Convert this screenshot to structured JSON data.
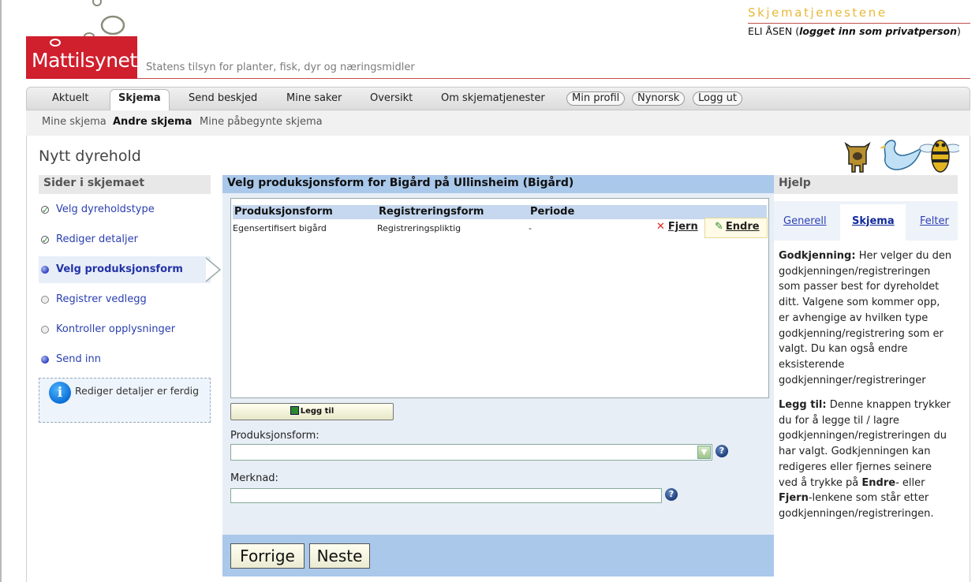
{
  "header": {
    "brand": "Mattilsynet",
    "tagline": "Statens tilsyn for planter, fisk, dyr og næringsmidler",
    "service_title": "Skjematjenestene",
    "user_name": "ELI ÅSEN",
    "user_status": "logget inn som privatperson",
    "paren_open": " (",
    "paren_close": ")",
    "brand_color": "#d01f2d",
    "accent_color": "#e8b838"
  },
  "nav": {
    "tabs": [
      "Aktuelt",
      "Skjema",
      "Send beskjed",
      "Mine saker",
      "Oversikt",
      "Om skjematjenester"
    ],
    "active_tab": "Skjema",
    "pills": [
      "Min profil",
      "Nynorsk",
      "Logg ut"
    ],
    "subtabs": [
      "Mine skjema",
      "Andre skjema",
      "Mine påbegynte skjema"
    ],
    "active_subtab": "Andre skjema"
  },
  "page": {
    "title": "Nytt dyrehold"
  },
  "sidebar": {
    "heading": "Sider i skjemaet",
    "steps": [
      {
        "label": "Velg dyreholdstype",
        "state": "done"
      },
      {
        "label": "Rediger detaljer",
        "state": "done"
      },
      {
        "label": "Velg produksjonsform",
        "state": "current"
      },
      {
        "label": "Registrer vedlegg",
        "state": "todo"
      },
      {
        "label": "Kontroller opplysninger",
        "state": "todo"
      },
      {
        "label": "Send inn",
        "state": "blue"
      }
    ],
    "info_icon": "i",
    "info_text": "Rediger detaljer er ferdig"
  },
  "main": {
    "heading": "Velg produksjonsform for Bigård på Ullinsheim (Bigård)",
    "columns": [
      "Produksjonsform",
      "Registreringsform",
      "Periode"
    ],
    "rows": [
      {
        "produksjonsform": "Egensertifisert bigård",
        "registreringsform": "Registreringspliktig",
        "periode": "-",
        "remove": "Fjern",
        "edit": "Endre"
      }
    ],
    "add_label": "Legg til",
    "fields": {
      "produksjonsform_label": "Produksjonsform:",
      "produksjonsform_value": "",
      "merknad_label": "Merknad:",
      "merknad_value": ""
    },
    "help_glyph": "?",
    "prev_label": "Forrige",
    "next_label": "Neste"
  },
  "help": {
    "heading": "Hjelp",
    "tabs": [
      "Generell",
      "Skjema",
      "Felter"
    ],
    "active_tab": "Skjema",
    "p1_bold": "Godkjenning:",
    "p1_lines": [
      " Her velger du den",
      "godkjenningen/registreringen",
      "som passer best for dyreholdet",
      "ditt. Valgene som kommer opp,",
      "er avhengige av hvilken type",
      "godkjenning/registrering som er",
      "valgt. Du kan også endre",
      "eksisterende",
      "godkjenninger/registreringer"
    ],
    "p2_bold": "Legg til:",
    "p2_lines": [
      " Denne knappen trykker",
      "du for å legge til / lagre",
      "godkjenningen/registreringen du",
      "har valgt. Godkjenningen kan",
      "redigeres eller fjernes seinere",
      "ved å trykke på "
    ],
    "p2_endre": "Endre",
    "p2_after_endre": "- eller",
    "p2_fjern": "Fjern",
    "p2_tail_lines": [
      "-lenkene som står etter",
      "godkjenningen/registreringen."
    ]
  }
}
